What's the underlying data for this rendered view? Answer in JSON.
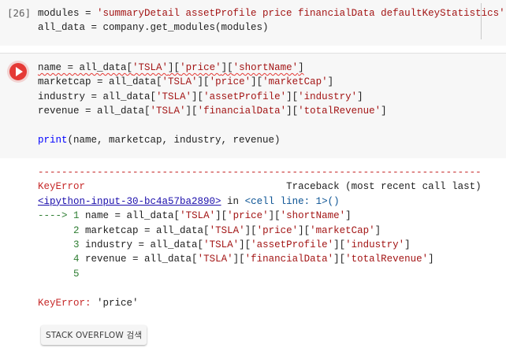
{
  "cell1": {
    "exec_count": "[26]",
    "lines": [
      {
        "pre": "modules = ",
        "str": "'summaryDetail assetProfile price financialData defaultKeyStatistics'"
      },
      {
        "text": "all_data = company.get_modules(modules)"
      }
    ]
  },
  "cell2": {
    "lines": [
      "name = all_data['TSLA']['price']['shortName']",
      "marketcap = all_data['TSLA']['price']['marketCap']",
      "industry = all_data['TSLA']['assetProfile']['industry']",
      "revenue = all_data['TSLA']['financialData']['totalRevenue']",
      "",
      "print(name, marketcap, industry, revenue)"
    ]
  },
  "output": {
    "divider": "---------------------------------------------------------------------------",
    "error_type": "KeyError",
    "traceback_label": "Traceback (most recent call last)",
    "input_link": "<ipython-input-30-bc4a57ba2890>",
    "in_word": " in ",
    "cell_line": "<cell line: 1>()",
    "arrow": "----> ",
    "trace_lines": [
      {
        "num": "1",
        "code": "name = all_data['TSLA']['price']['shortName']"
      },
      {
        "num": "2",
        "code": "marketcap = all_data['TSLA']['price']['marketCap']"
      },
      {
        "num": "3",
        "code": "industry = all_data['TSLA']['assetProfile']['industry']"
      },
      {
        "num": "4",
        "code": "revenue = all_data['TSLA']['financialData']['totalRevenue']"
      },
      {
        "num": "5",
        "code": ""
      }
    ],
    "final_error_name": "KeyError:",
    "final_error_msg": " 'price'"
  },
  "so_button": "STACK OVERFLOW 검색",
  "colors": {
    "run_button": "#e53935",
    "error": "#c62828",
    "link": "#1a0dab",
    "string": "#a31515"
  }
}
